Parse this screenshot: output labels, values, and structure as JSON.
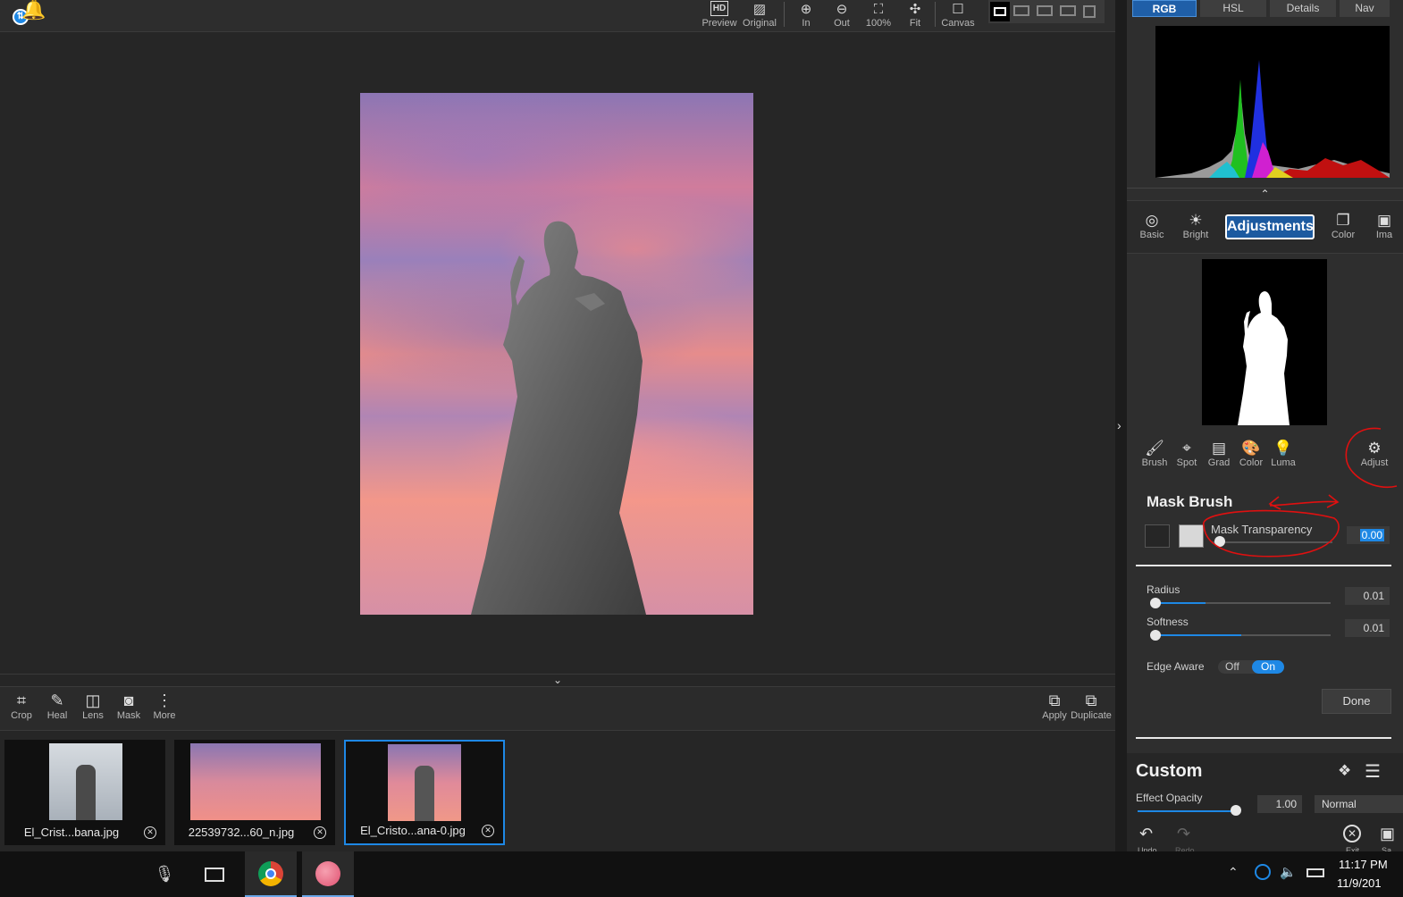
{
  "topbar": {
    "buttons": [
      {
        "label": "Preview",
        "icon": "hd-icon"
      },
      {
        "label": "Original",
        "icon": "image-icon"
      },
      {
        "label": "In",
        "icon": "zoom-in-icon"
      },
      {
        "label": "Out",
        "icon": "zoom-out-icon"
      },
      {
        "label": "100%",
        "icon": "actual-size-icon"
      },
      {
        "label": "Fit",
        "icon": "fit-icon"
      },
      {
        "label": "Canvas",
        "icon": "canvas-icon"
      }
    ]
  },
  "tools": [
    {
      "label": "Crop",
      "icon": "crop-icon"
    },
    {
      "label": "Heal",
      "icon": "bandage-icon"
    },
    {
      "label": "Lens",
      "icon": "lens-icon"
    },
    {
      "label": "Mask",
      "icon": "mask-icon"
    },
    {
      "label": "More",
      "icon": "more-icon"
    }
  ],
  "actions": [
    {
      "label": "Apply",
      "icon": "apply-icon"
    },
    {
      "label": "Duplicate",
      "icon": "duplicate-icon"
    }
  ],
  "filmstrip": [
    {
      "name": "El_Crist...bana.jpg",
      "selected": false
    },
    {
      "name": "22539732...60_n.jpg",
      "selected": false
    },
    {
      "name": "El_Cristo...ana-0.jpg",
      "selected": true
    }
  ],
  "panel": {
    "tabs": [
      "RGB",
      "HSL",
      "Details",
      "Nav"
    ],
    "active_tab": "RGB",
    "modules": [
      {
        "label": "Basic",
        "icon": "aperture-icon"
      },
      {
        "label": "Bright",
        "icon": "sun-icon"
      },
      {
        "label": "Adjustments",
        "icon": ""
      },
      {
        "label": "Color",
        "icon": "color-icon"
      },
      {
        "label": "Ima",
        "icon": "image-icon"
      }
    ],
    "mask_tools": [
      {
        "label": "Brush",
        "icon": "brush-icon"
      },
      {
        "label": "Spot",
        "icon": "spot-icon"
      },
      {
        "label": "Grad",
        "icon": "gradient-icon"
      },
      {
        "label": "Color",
        "icon": "palette-icon"
      },
      {
        "label": "Luma",
        "icon": "bulb-icon"
      },
      {
        "label": "Adjust",
        "icon": "gears-icon"
      }
    ],
    "mask_brush": {
      "title": "Mask Brush",
      "transparency_label": "Mask Transparency",
      "transparency_value": "0.00",
      "radius_label": "Radius",
      "radius_value": "0.01",
      "radius_level": 0.01,
      "softness_label": "Softness",
      "softness_value": "0.01",
      "softness_level": 0.01,
      "edge_aware_label": "Edge Aware",
      "edge_off": "Off",
      "edge_on": "On",
      "done_label": "Done"
    },
    "custom": {
      "title": "Custom",
      "opacity_label": "Effect Opacity",
      "opacity_value": "1.00",
      "blend_mode": "Normal",
      "undo_label": "Undo",
      "redo_label": "Redo",
      "exit_label": "Exit",
      "save_label": "Sa"
    }
  },
  "taskbar": {
    "time": "11:17 PM",
    "date": "11/9/201"
  },
  "colors": {
    "accent": "#1e88e5",
    "annotation": "#e01010"
  }
}
